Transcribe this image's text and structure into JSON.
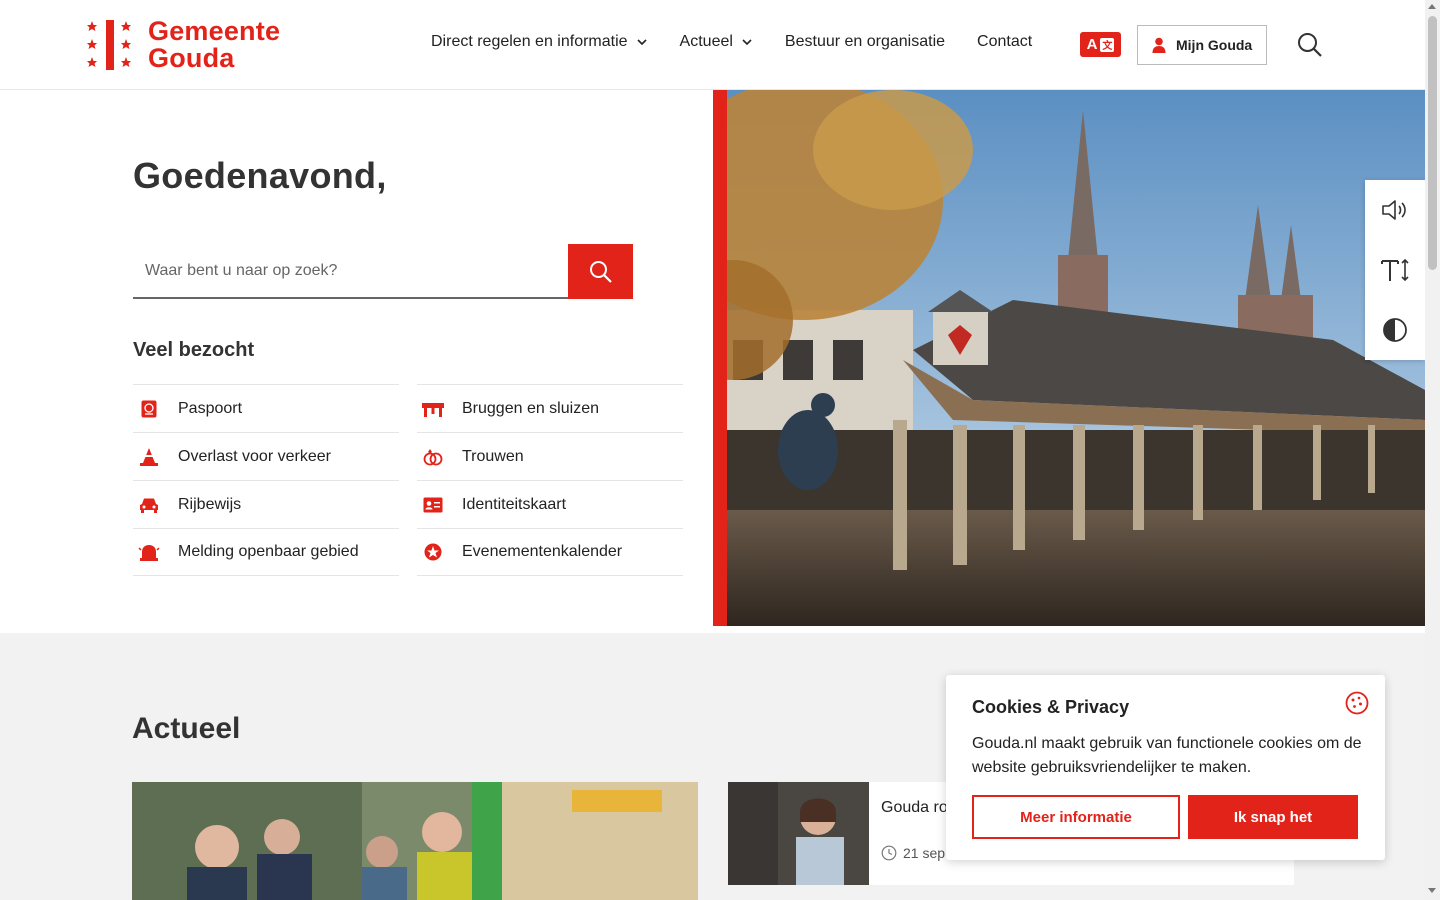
{
  "header": {
    "logo_line1": "Gemeente",
    "logo_line2": "Gouda",
    "nav": [
      {
        "label": "Direct regelen en informatie",
        "has_dropdown": true
      },
      {
        "label": "Actueel",
        "has_dropdown": true
      },
      {
        "label": "Bestuur en organisatie",
        "has_dropdown": false
      },
      {
        "label": "Contact",
        "has_dropdown": false
      }
    ],
    "language_button": {
      "latin": "A",
      "icon": "translate-icon"
    },
    "mijn_gouda_label": "Mijn Gouda",
    "search_icon": "search-icon"
  },
  "hero": {
    "greeting": "Goedenavond,",
    "search_placeholder": "Waar bent u naar op zoek?",
    "popular_title": "Veel bezocht",
    "popular_items": [
      {
        "label": "Paspoort",
        "icon": "passport-icon"
      },
      {
        "label": "Bruggen en sluizen",
        "icon": "bridge-icon"
      },
      {
        "label": "Overlast voor verkeer",
        "icon": "traffic-cone-icon"
      },
      {
        "label": "Trouwen",
        "icon": "rings-icon"
      },
      {
        "label": "Rijbewijs",
        "icon": "car-icon"
      },
      {
        "label": "Identiteitskaart",
        "icon": "id-card-icon"
      },
      {
        "label": "Melding openbaar gebied",
        "icon": "alarm-bell-icon"
      },
      {
        "label": "Evenementenkalender",
        "icon": "event-icon"
      }
    ]
  },
  "accessibility_tools": [
    {
      "name": "read-aloud",
      "icon": "speaker-icon"
    },
    {
      "name": "text-size",
      "icon": "text-size-icon"
    },
    {
      "name": "contrast",
      "icon": "contrast-icon"
    }
  ],
  "actueel": {
    "title": "Actueel",
    "news": [
      {
        "title": "Gouda ro horen erk",
        "date": "21 sep"
      }
    ]
  },
  "cookie": {
    "title": "Cookies & Privacy",
    "text": "Gouda.nl maakt gebruik van functionele cookies om de website gebruiksvriendelijker te maken.",
    "more_label": "Meer informatie",
    "accept_label": "Ik snap het"
  },
  "colors": {
    "brand_red": "#e2231a",
    "section_bg": "#f2f2f2"
  }
}
